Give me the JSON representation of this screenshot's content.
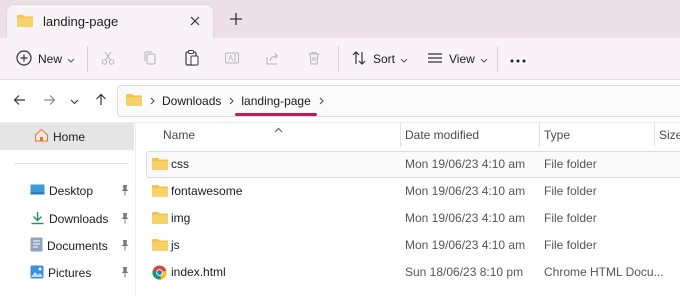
{
  "tab": {
    "title": "landing-page",
    "close_icon": "close-icon",
    "new_tab_icon": "plus-icon"
  },
  "toolbar": {
    "new_label": "New",
    "sort_label": "Sort",
    "view_label": "View",
    "icons": [
      "cut-icon",
      "copy-icon",
      "paste-icon",
      "rename-icon",
      "share-icon",
      "delete-icon",
      "more-icon"
    ]
  },
  "breadcrumb": {
    "items": [
      "Downloads",
      "landing-page"
    ]
  },
  "sidebar": {
    "home": "Home",
    "quick_access": [
      {
        "label": "Desktop",
        "icon": "desktop-icon"
      },
      {
        "label": "Downloads",
        "icon": "download-icon"
      },
      {
        "label": "Documents",
        "icon": "documents-icon"
      },
      {
        "label": "Pictures",
        "icon": "pictures-icon"
      }
    ]
  },
  "columns": {
    "name": "Name",
    "date": "Date modified",
    "type": "Type",
    "size": "Size"
  },
  "files": [
    {
      "name": "css",
      "date": "Mon 19/06/23 4:10 am",
      "type": "File folder",
      "icon": "folder-icon"
    },
    {
      "name": "fontawesome",
      "date": "Mon 19/06/23 4:10 am",
      "type": "File folder",
      "icon": "folder-icon"
    },
    {
      "name": "img",
      "date": "Mon 19/06/23 4:10 am",
      "type": "File folder",
      "icon": "folder-icon"
    },
    {
      "name": "js",
      "date": "Mon 19/06/23 4:10 am",
      "type": "File folder",
      "icon": "folder-icon"
    },
    {
      "name": "index.html",
      "date": "Sun 18/06/23 8:10 pm",
      "type": "Chrome HTML Docu...",
      "icon": "chrome-icon"
    }
  ],
  "colors": {
    "accent_underline": "#c2185b",
    "folder": "#f2c24a",
    "chrome_blue": "#1a73e8"
  }
}
